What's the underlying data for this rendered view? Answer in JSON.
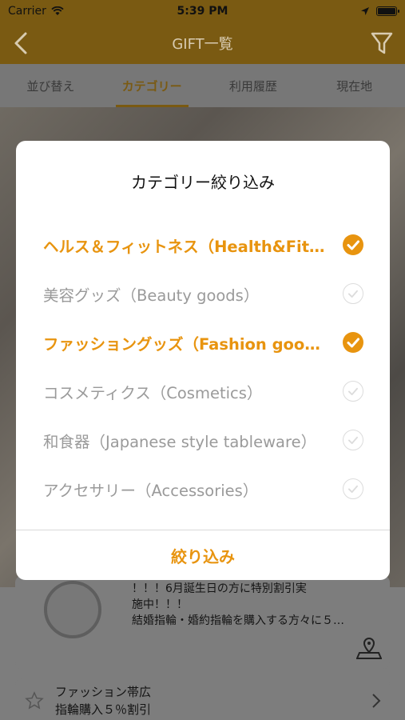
{
  "status_bar": {
    "carrier": "Carrier",
    "time": "5:39 PM"
  },
  "navbar": {
    "title": "GIFT一覧"
  },
  "tabs": [
    {
      "label": "並び替え",
      "active": false
    },
    {
      "label": "カテゴリー",
      "active": true
    },
    {
      "label": "利用履歴",
      "active": false
    },
    {
      "label": "現在地",
      "active": false
    }
  ],
  "modal": {
    "title": "カテゴリー絞り込み",
    "options": [
      {
        "label": "ヘルス＆フィットネス（Health&Fitness）",
        "checked": true
      },
      {
        "label": "美容グッズ（Beauty goods）",
        "checked": false
      },
      {
        "label": "ファッショングッズ（Fashion goods）",
        "checked": true
      },
      {
        "label": "コスメティクス（Cosmetics）",
        "checked": false
      },
      {
        "label": "和食器（Japanese style tableware）",
        "checked": false
      },
      {
        "label": "アクセサリー（Accessories）",
        "checked": false
      }
    ],
    "apply_label": "絞り込み"
  },
  "background": {
    "card1": {
      "line1": "！！！6月誕生日の方に特別割引実",
      "line2": "施中！！！",
      "line3": "結婚指輪・婚約指輪を購入する方々に５…"
    },
    "card2": {
      "line1": "ファッション帯広",
      "line2": "指輪購入５％割引"
    }
  },
  "colors": {
    "accent": "#e8940f",
    "header": "#e8a317",
    "unchecked": "#9a9a9a"
  }
}
